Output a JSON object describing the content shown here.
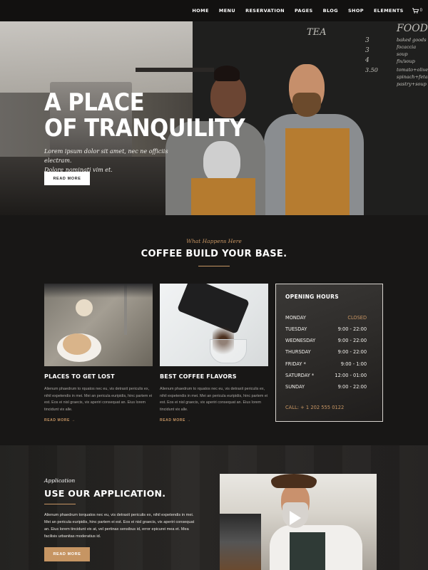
{
  "nav": {
    "items": [
      "HOME",
      "MENU",
      "RESERVATION",
      "PAGES",
      "BLOG",
      "SHOP",
      "ELEMENTS"
    ],
    "cart_count": "0"
  },
  "hero": {
    "title_line1": "A PLACE",
    "title_line2": "OF TRANQUILITY",
    "text_line1": "Lorem ipsum dolor sit amet, nec ne officiis electram.",
    "text_line2": "Dolore nominati vim et.",
    "button": "READ MORE",
    "chalk_tea": "TEA",
    "chalk_food": "FOOD",
    "chalk_items": [
      "baked goods",
      "focaccia",
      "soup",
      "fix/soup",
      "tomato+olive",
      "spinach+feta",
      "pastry+soup"
    ],
    "chalk_prices": [
      "3",
      "3",
      "4",
      "3.50"
    ]
  },
  "intro": {
    "eyebrow": "What Happens Here",
    "title": "COFFEE BUILD YOUR BASE."
  },
  "cards": [
    {
      "title": "PLACES TO GET LOST",
      "text": "Alienum phaedrum to rquatos nec eu, vis detraxit periculis ex, nihil expetendis in mei. Mei an pericula euripidis, hinc partem ei est. Eos ei nisl graecis, vix aperiri consequat an. Eius lorem tincidunt vix alle.",
      "link": "READ MORE"
    },
    {
      "title": "BEST COFFEE FLAVORS",
      "text": "Alienum phaedrum to rquatos nec eu, vis detraxit periculis ex, nihil expetendis in mei. Mei an pericula euripidis, hinc partem ei est. Eos ei nisl graecis, vix aperiri consequat an. Eius lorem tincidunt vix alle.",
      "link": "READ MORE"
    }
  ],
  "hours": {
    "title": "OPENING HOURS",
    "rows": [
      {
        "day": "MONDAY",
        "time": "CLOSED"
      },
      {
        "day": "TUESDAY",
        "time": "9:00 - 22:00"
      },
      {
        "day": "WEDNESDAY",
        "time": "9:00 - 22:00"
      },
      {
        "day": "THURSDAY",
        "time": "9:00 - 22:00"
      },
      {
        "day": "FRIDAY *",
        "time": "9:00 - 1:00"
      },
      {
        "day": "SATURDAY *",
        "time": "12:00 - 01:00"
      },
      {
        "day": "SUNDAY",
        "time": "9:00 - 22:00"
      }
    ],
    "call": "CALL: + 1 202 555 0122"
  },
  "app": {
    "eyebrow": "Application",
    "title": "USE OUR APPLICATION.",
    "text": "Alienum phaedrum torquatos nec eu, vis detraxit periculis ex, nihil expetendis in mei. Mei an pericula euripidis, hinc partem ei est. Eos ei nisl graecis, vix aperiri consequat an. Eius lorem tincidunt vix at, vel pertinax sensibus id, error epicurei mea et. Mea facilisis urbanitas moderatius id.",
    "button": "READ MORE"
  },
  "colors": {
    "accent": "#c69563",
    "background": "#181716"
  }
}
